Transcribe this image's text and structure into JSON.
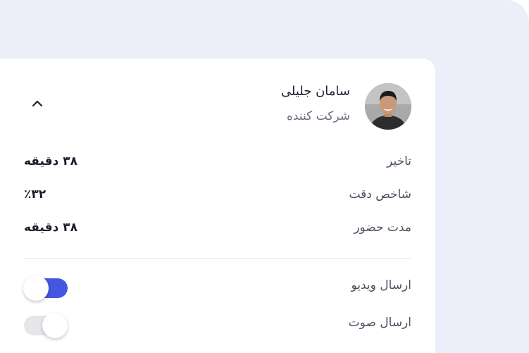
{
  "participant": {
    "name": "سامان جلیلی",
    "role": "شرکت کننده",
    "avatar_icon": "user-photo"
  },
  "stats": [
    {
      "label": "تاخیر",
      "value": "۳۸ دقیقه"
    },
    {
      "label": "شاخص دقت",
      "value": "٪۳۲"
    },
    {
      "label": "مدت حضور",
      "value": "۳۸ دقیقه"
    }
  ],
  "toggles": [
    {
      "label": "ارسال ویدیو",
      "state": "on"
    },
    {
      "label": "ارسال صوت",
      "state": "off"
    }
  ],
  "colors": {
    "background": "#eceff9",
    "accent": "#4457e0",
    "toggle_off": "#e5e6ea"
  },
  "icons": {
    "collapse": "chevron-up-icon"
  }
}
